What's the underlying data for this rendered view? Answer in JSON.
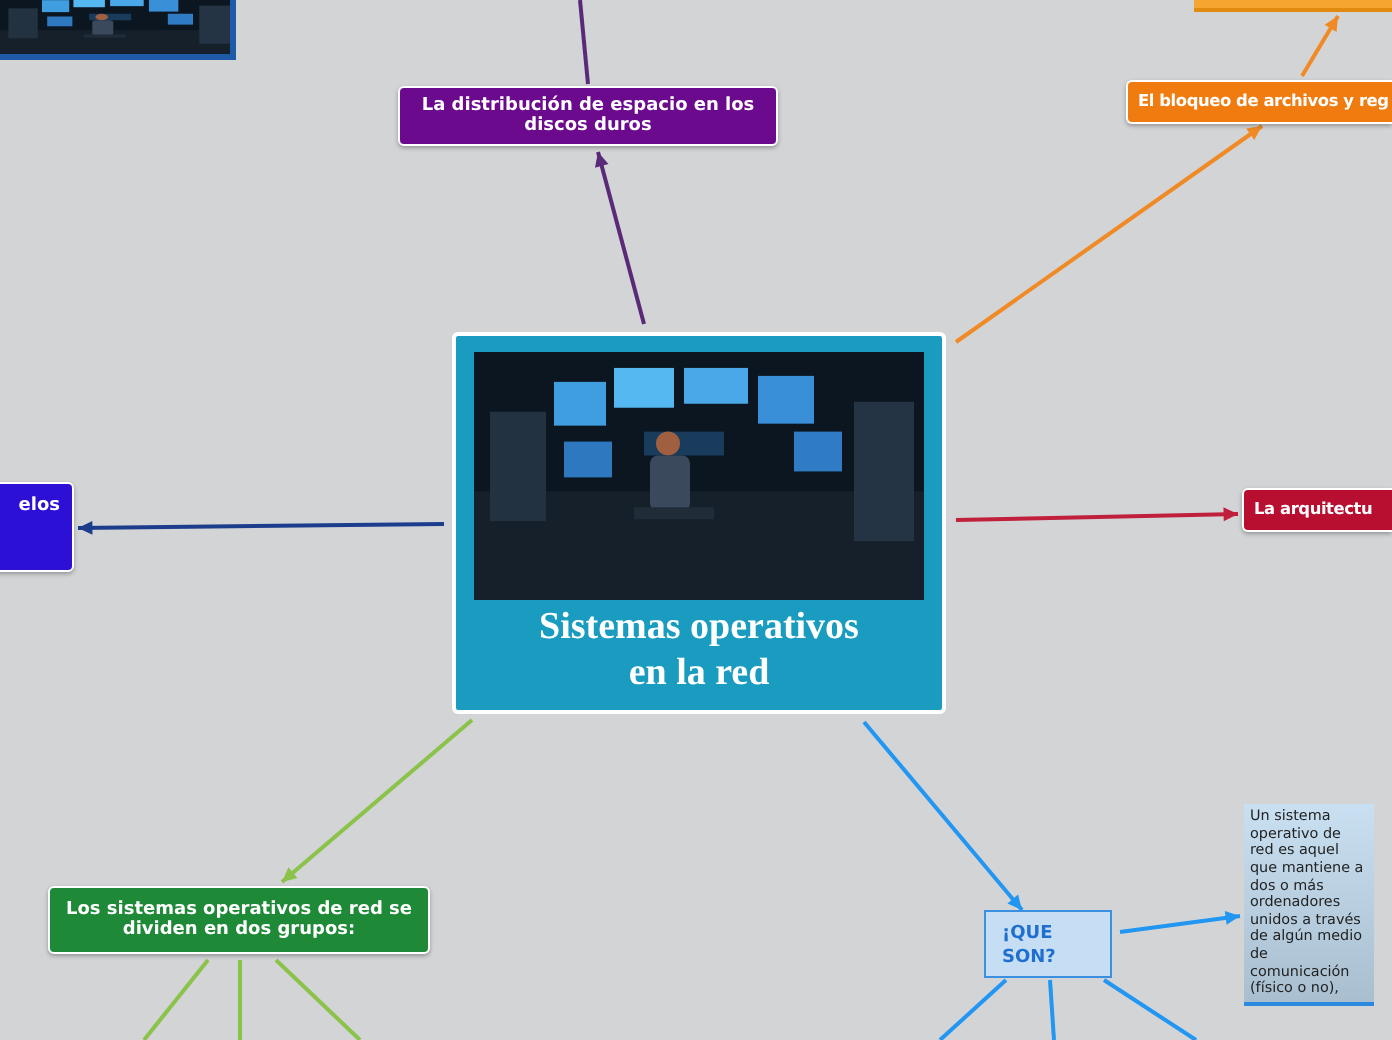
{
  "nodes": [
    {
      "kind": "picture"
    },
    {
      "kind": "fragment",
      "color": "#f5a530"
    },
    {
      "kind": "topic",
      "text": "La distribución de espacio en los discos duros",
      "color": "#6c0a8e"
    },
    {
      "kind": "topic",
      "text": "El bloqueo de archivos y reg",
      "color": "#f07b0e"
    },
    {
      "kind": "topic",
      "text": "elos",
      "color": "#2c10d6"
    },
    {
      "kind": "central",
      "text": "Sistemas operativos en la red",
      "color": "#1a9cc0"
    },
    {
      "kind": "topic",
      "text": "La arquitectu",
      "color": "#b80e30"
    },
    {
      "kind": "topic",
      "text": "Los sistemas operativos de red se dividen en dos grupos:",
      "color": "#1e8a38"
    },
    {
      "kind": "subtopic",
      "text": "¡QUE SON?",
      "color": "#c6def4"
    },
    {
      "kind": "note",
      "text": "Un sistema operativo de red es aquel que mantiene a dos o más ordenadores unidos a través de algún medio de comunicación (físico o no),",
      "color": "#c9e0f2"
    }
  ]
}
